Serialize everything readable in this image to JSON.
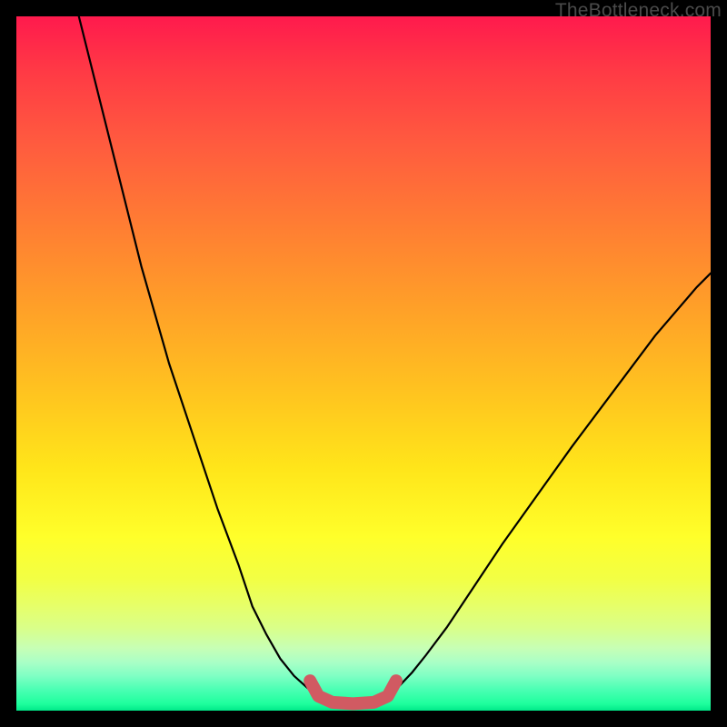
{
  "watermark": "TheBottleneck.com",
  "chart_data": {
    "type": "line",
    "title": "",
    "xlabel": "",
    "ylabel": "",
    "xlim": [
      0,
      100
    ],
    "ylim": [
      0,
      100
    ],
    "series": [
      {
        "name": "left-curve",
        "x": [
          9,
          14,
          18,
          22,
          26,
          29,
          32,
          34,
          36,
          38,
          40,
          42,
          43.5
        ],
        "y": [
          100,
          80,
          64,
          50,
          38,
          29,
          21,
          15,
          11,
          7.5,
          5,
          3.2,
          2.1
        ]
      },
      {
        "name": "right-curve",
        "x": [
          53.5,
          55,
          57,
          59,
          62,
          66,
          70,
          75,
          80,
          86,
          92,
          98,
          100
        ],
        "y": [
          2.1,
          3.4,
          5.5,
          8,
          12,
          18,
          24,
          31,
          38,
          46,
          54,
          61,
          63
        ]
      },
      {
        "name": "highlight-segment",
        "x": [
          42.3,
          43.5,
          45.5,
          48.5,
          51.5,
          53.5,
          54.7
        ],
        "y": [
          4.3,
          2.1,
          1.2,
          1.0,
          1.2,
          2.1,
          4.3
        ]
      }
    ],
    "colors": {
      "curve": "#000000",
      "highlight": "#d15a62",
      "background_top": "#ff1a4d",
      "background_bottom": "#00e989"
    }
  }
}
